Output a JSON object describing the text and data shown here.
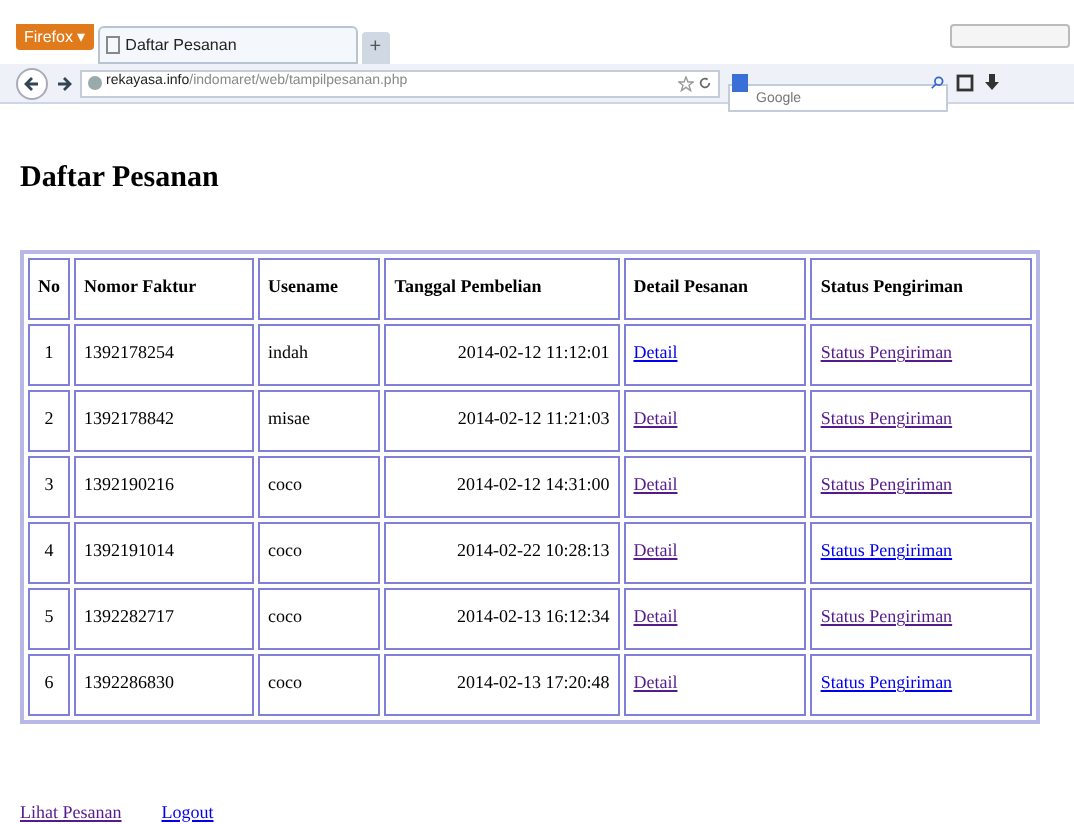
{
  "browser": {
    "menu_button": "Firefox ▾",
    "tab_title": "Daftar Pesanan",
    "new_tab": "+",
    "address_host": "rekayasa.info",
    "address_path": "/indomaret/web/tampilpesanan.php",
    "search_placeholder": "Google"
  },
  "page": {
    "title": "Daftar Pesanan",
    "table": {
      "columns": [
        "No",
        "Nomor Faktur",
        "Usename",
        "Tanggal Pembelian",
        "Detail Pesanan",
        "Status Pengiriman"
      ],
      "rows": [
        {
          "no": "1",
          "faktur": "1392178254",
          "user": "indah",
          "tanggal": "2014-02-12 11:12:01",
          "detail": {
            "text": "Detail",
            "visited": false
          },
          "status": {
            "text": "Status Pengiriman",
            "visited": true
          }
        },
        {
          "no": "2",
          "faktur": "1392178842",
          "user": "misae",
          "tanggal": "2014-02-12 11:21:03",
          "detail": {
            "text": "Detail",
            "visited": true
          },
          "status": {
            "text": "Status Pengiriman",
            "visited": true
          }
        },
        {
          "no": "3",
          "faktur": "1392190216",
          "user": "coco",
          "tanggal": "2014-02-12 14:31:00",
          "detail": {
            "text": "Detail",
            "visited": true
          },
          "status": {
            "text": "Status Pengiriman",
            "visited": true
          }
        },
        {
          "no": "4",
          "faktur": "1392191014",
          "user": "coco",
          "tanggal": "2014-02-22 10:28:13",
          "detail": {
            "text": "Detail",
            "visited": true
          },
          "status": {
            "text": "Status Pengiriman",
            "visited": false
          }
        },
        {
          "no": "5",
          "faktur": "1392282717",
          "user": "coco",
          "tanggal": "2014-02-13 16:12:34",
          "detail": {
            "text": "Detail",
            "visited": true
          },
          "status": {
            "text": "Status Pengiriman",
            "visited": true
          }
        },
        {
          "no": "6",
          "faktur": "1392286830",
          "user": "coco",
          "tanggal": "2014-02-13 17:20:48",
          "detail": {
            "text": "Detail",
            "visited": true
          },
          "status": {
            "text": "Status Pengiriman",
            "visited": false
          }
        }
      ]
    },
    "links": [
      {
        "text": "Lihat Pesanan",
        "visited": true
      },
      {
        "text": "Logout",
        "visited": false
      }
    ]
  }
}
